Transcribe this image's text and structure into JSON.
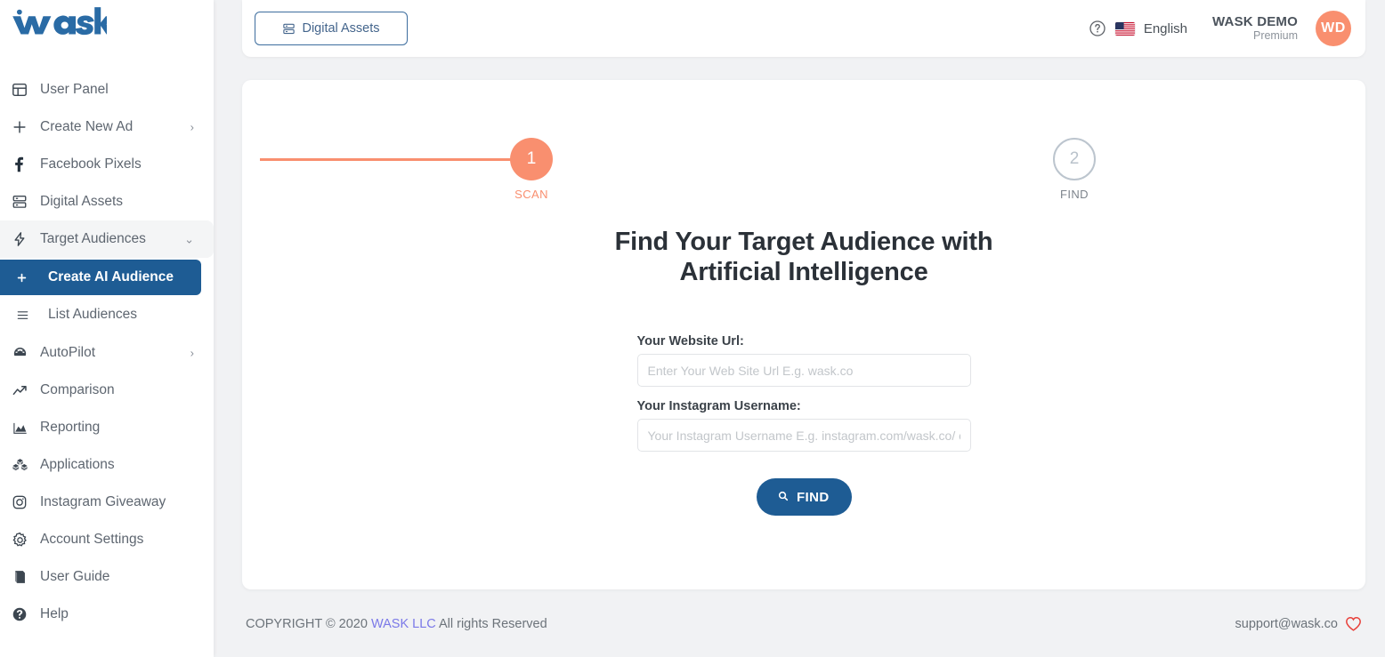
{
  "brand": {
    "logo_text": "wask",
    "logo_color": "#2a6ba5"
  },
  "sidebar": {
    "items": [
      {
        "label": "User Panel",
        "icon": "layout-panel-icon",
        "has_chevron": false
      },
      {
        "label": "Create New Ad",
        "icon": "plus-icon",
        "has_chevron": true
      },
      {
        "label": "Facebook Pixels",
        "icon": "facebook-icon",
        "has_chevron": false
      },
      {
        "label": "Digital Assets",
        "icon": "server-stack-icon",
        "has_chevron": false
      },
      {
        "label": "Target Audiences",
        "icon": "lightning-bolt-icon",
        "has_chevron": true,
        "expanded": true
      },
      {
        "label": "AutoPilot",
        "icon": "speedometer-icon",
        "has_chevron": true
      },
      {
        "label": "Comparison",
        "icon": "trend-up-icon",
        "has_chevron": false
      },
      {
        "label": "Reporting",
        "icon": "area-chart-icon",
        "has_chevron": false
      },
      {
        "label": "Applications",
        "icon": "cubes-icon",
        "has_chevron": false
      },
      {
        "label": "Instagram Giveaway",
        "icon": "instagram-icon",
        "has_chevron": false
      },
      {
        "label": "Account Settings",
        "icon": "gear-icon",
        "has_chevron": false
      },
      {
        "label": "User Guide",
        "icon": "book-icon",
        "has_chevron": false
      },
      {
        "label": "Help",
        "icon": "question-circle-icon",
        "has_chevron": false
      }
    ],
    "subitems": [
      {
        "label": "Create AI Audience",
        "icon": "plus-icon",
        "active": true
      },
      {
        "label": "List Audiences",
        "icon": "list-icon",
        "active": false
      }
    ],
    "active_color": "#1e5c94"
  },
  "header": {
    "digital_assets_button": "Digital Assets",
    "digital_assets_icon": "server-stack-icon",
    "help_icon": "question-circle-icon",
    "flag_icon": "us-flag-icon",
    "language": "English",
    "account_name": "WASK DEMO",
    "account_plan": "Premium",
    "avatar_initials": "WD",
    "avatar_color": "#f98f6f"
  },
  "stepper": {
    "active_color": "#f98f6f",
    "inactive_color": "#bcc5ce",
    "steps": [
      {
        "number": "1",
        "name": "SCAN",
        "active": true
      },
      {
        "number": "2",
        "name": "FIND",
        "active": false
      }
    ]
  },
  "main": {
    "headline": "Find Your Target Audience with Artificial Intelligence",
    "website_label": "Your Website Url:",
    "website_placeholder": "Enter Your Web Site Url E.g. wask.co",
    "website_value": "",
    "instagram_label": "Your Instagram Username:",
    "instagram_placeholder": "Your Instagram Username E.g. instagram.com/wask.co/ or wask.co",
    "instagram_value": "",
    "find_button": "FIND",
    "find_icon": "search-icon",
    "find_button_color": "#1e5c94"
  },
  "footer": {
    "copyright_prefix": "COPYRIGHT © 2020 ",
    "copyright_link": "WASK LLC",
    "copyright_suffix": " All rights Reserved",
    "support_email": "support@wask.co",
    "heart_icon": "heart-icon",
    "heart_color": "#e8403a"
  }
}
